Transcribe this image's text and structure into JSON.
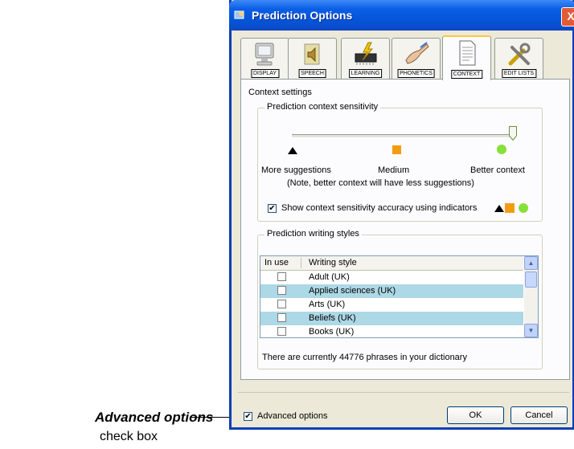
{
  "callout": {
    "title": "Advanced options",
    "subtitle": "check box"
  },
  "window": {
    "title": "Prediction Options",
    "close_label": "X"
  },
  "tabs": [
    {
      "label": "DISPLAY",
      "icon": "monitor-icon"
    },
    {
      "label": "SPEECH",
      "icon": "speaker-icon"
    },
    {
      "label": "LEARNING",
      "icon": "chip-lightning-icon"
    },
    {
      "label": "PHONETICS",
      "icon": "hand-writing-icon"
    },
    {
      "label": "CONTEXT",
      "icon": "document-icon",
      "active": true
    },
    {
      "label": "EDIT LISTS",
      "icon": "tools-icon"
    }
  ],
  "context": {
    "group_label": "Context settings",
    "sensitivity": {
      "group_label": "Prediction context sensitivity",
      "label_left": "More suggestions",
      "label_mid": "Medium",
      "label_right": "Better context",
      "note": "(Note, better context will have less suggestions)",
      "level": 1.0,
      "show_indicators_label": "Show  context  sensitivity  accuracy  using indicators",
      "show_indicators_checked": "✔",
      "indicator_colors": {
        "triangle": "#000000",
        "square": "#f39c12",
        "circle": "#88e03a"
      }
    },
    "styles": {
      "group_label": "Prediction writing styles",
      "col_in_use": "In use",
      "col_style": "Writing style",
      "rows": [
        {
          "name": "Adult (UK)",
          "highlight": false
        },
        {
          "name": "Applied sciences (UK)",
          "highlight": true
        },
        {
          "name": "Arts (UK)",
          "highlight": false
        },
        {
          "name": "Beliefs (UK)",
          "highlight": true
        },
        {
          "name": "Books (UK)",
          "highlight": false
        }
      ],
      "dictionary_text": "There are currently 44776 phrases in your dictionary"
    }
  },
  "footer": {
    "advanced_label": "Advanced options",
    "advanced_checked": "✔",
    "ok_label": "OK",
    "cancel_label": "Cancel"
  }
}
